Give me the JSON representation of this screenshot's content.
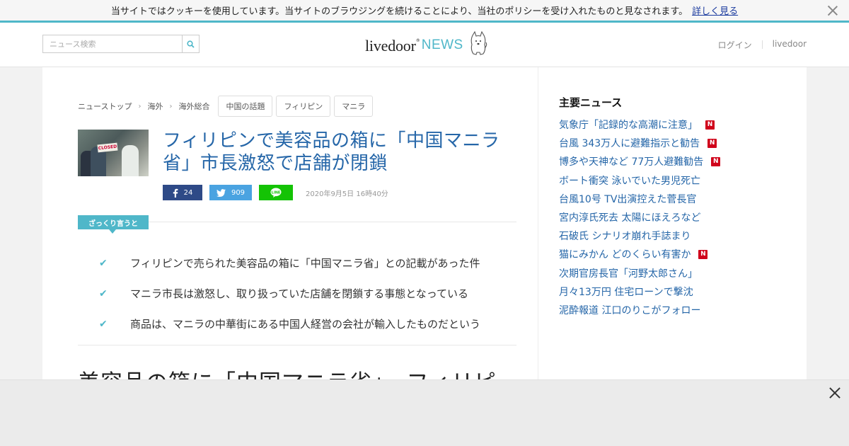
{
  "cookie_bar": {
    "text": "当サイトではクッキーを使用しています。当サイトのブラウジングを続けることにより、当社のポリシーを受け入れたものと見なされます。",
    "link": "詳しく見る"
  },
  "header": {
    "search_placeholder": "ニュース検索",
    "logo_live": "livedoor",
    "logo_news": "NEWS",
    "login": "ログイン",
    "livedoor_link": "livedoor"
  },
  "breadcrumb": [
    "ニューストップ",
    "海外",
    "海外総合"
  ],
  "tags": [
    "中国の話題",
    "フィリピン",
    "マニラ"
  ],
  "article": {
    "title": "フィリピンで美容品の箱に「中国マニラ省」市長激怒で店舗が閉鎖",
    "thumb_sign": "CLOSED",
    "facebook_count": "24",
    "twitter_count": "909",
    "date": "2020年9月5日 16時40分",
    "summary_label": "ざっくり言うと",
    "points": [
      "フィリピンで売られた美容品の箱に「中国マニラ省」との記載があった件",
      "マニラ市長は激怒し、取り扱っていた店舗を閉鎖する事態となっている",
      "商品は、マニラの中華街にある中国人経営の会社が輸入したものだという"
    ],
    "body_heading": "美容品の箱に「中国マニラ省」　フィリピ"
  },
  "sidebar": {
    "title": "主要ニュース",
    "items": [
      {
        "text": "気象庁「記録的な高潮に注意」",
        "new": "N"
      },
      {
        "text": "台風 343万人に避難指示と勧告",
        "new": "N"
      },
      {
        "text": "博多や天神など 77万人避難勧告",
        "new": "N"
      },
      {
        "text": "ボート衝突 泳いでいた男児死亡",
        "new": ""
      },
      {
        "text": "台風10号 TV出演控えた菅長官",
        "new": ""
      },
      {
        "text": "宮内淳氏死去 太陽にほえろなど",
        "new": ""
      },
      {
        "text": "石破氏 シナリオ崩れ手誌まり",
        "new": ""
      },
      {
        "text": "猫にみかん どのくらい有害か",
        "new": "N"
      },
      {
        "text": "次期官房長官「河野太郎さん」",
        "new": ""
      },
      {
        "text": "月々13万円 住宅ローンで撃沈",
        "new": ""
      },
      {
        "text": "泥酔報道 江口のりこがフォロー",
        "new": ""
      }
    ]
  },
  "colors": {
    "accent": "#4fb7c9",
    "headline_blue": "#2566a8",
    "facebook": "#2e4a87",
    "twitter": "#4aa3e1",
    "line": "#14c305",
    "new_badge": "#d0021b"
  }
}
